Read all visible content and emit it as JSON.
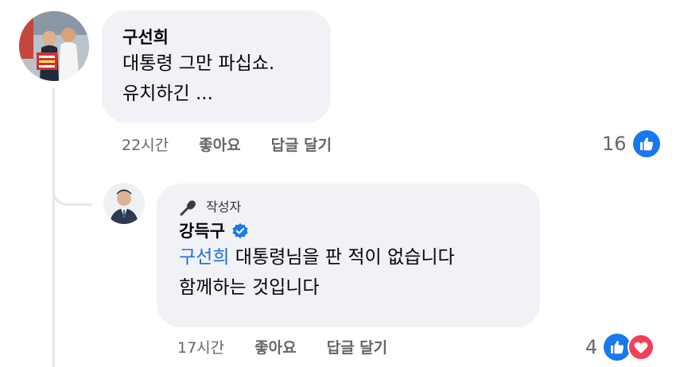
{
  "comments": [
    {
      "author": "구선희",
      "lines": [
        "대통령 그만 파십쇼.",
        "유치하긴 ..."
      ],
      "time": "22시간",
      "like_label": "좋아요",
      "reply_label": "답글 달기",
      "reaction_count": "16",
      "reactions": [
        "like-icon"
      ]
    },
    {
      "badge": "작성자",
      "author": "강득구",
      "verified": true,
      "mention": "구선희",
      "line1_rest": " 대통령님을 판 적이 없습니다",
      "line2": "함께하는 것입니다",
      "time": "17시간",
      "like_label": "좋아요",
      "reply_label": "답글 달기",
      "reaction_count": "4",
      "reactions": [
        "like-icon",
        "love-icon"
      ]
    }
  ],
  "colors": {
    "bubble": "#f0f2f5",
    "link": "#216fdb",
    "like": "#1877f2",
    "love": "#f33e58",
    "meta": "#65676b"
  }
}
